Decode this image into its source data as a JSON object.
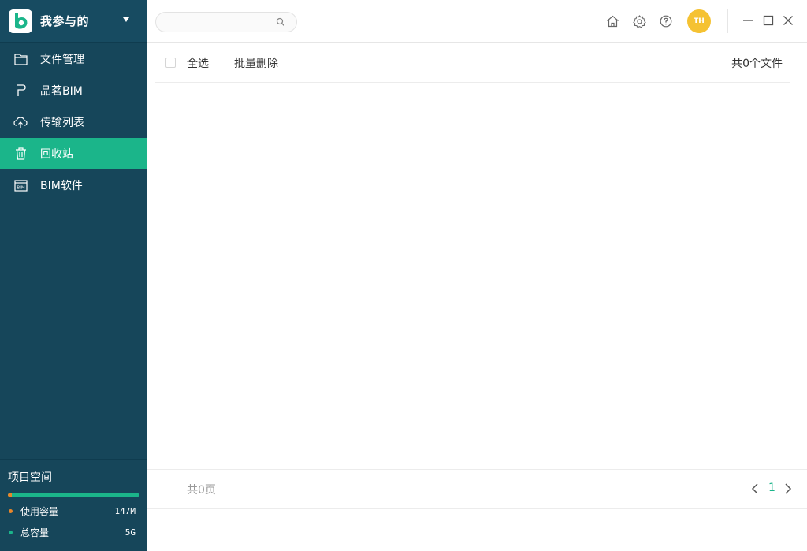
{
  "sidebar": {
    "title": "我参与的",
    "items": [
      {
        "label": "文件管理",
        "icon": "folder-icon"
      },
      {
        "label": "品茗BIM",
        "icon": "pinming-icon"
      },
      {
        "label": "传输列表",
        "icon": "cloud-upload-icon"
      },
      {
        "label": "回收站",
        "icon": "trash-icon",
        "active": true
      },
      {
        "label": "BIM软件",
        "icon": "bim-icon"
      }
    ],
    "space": {
      "title": "项目空间",
      "used_label": "使用容量",
      "used_value": "147M",
      "total_label": "总容量",
      "total_value": "5G",
      "used_fraction": 0.03
    }
  },
  "header": {
    "search_placeholder": "",
    "avatar_initials": "TH"
  },
  "toolbar": {
    "select_all": "全选",
    "batch_delete": "批量删除",
    "file_count": "共0个文件"
  },
  "footer": {
    "total_pages": "共0页",
    "current_page": "1"
  },
  "colors": {
    "sidebar_bg": "#16465a",
    "accent": "#1bb58a",
    "used": "#e8862a",
    "avatar": "#f5c232"
  }
}
